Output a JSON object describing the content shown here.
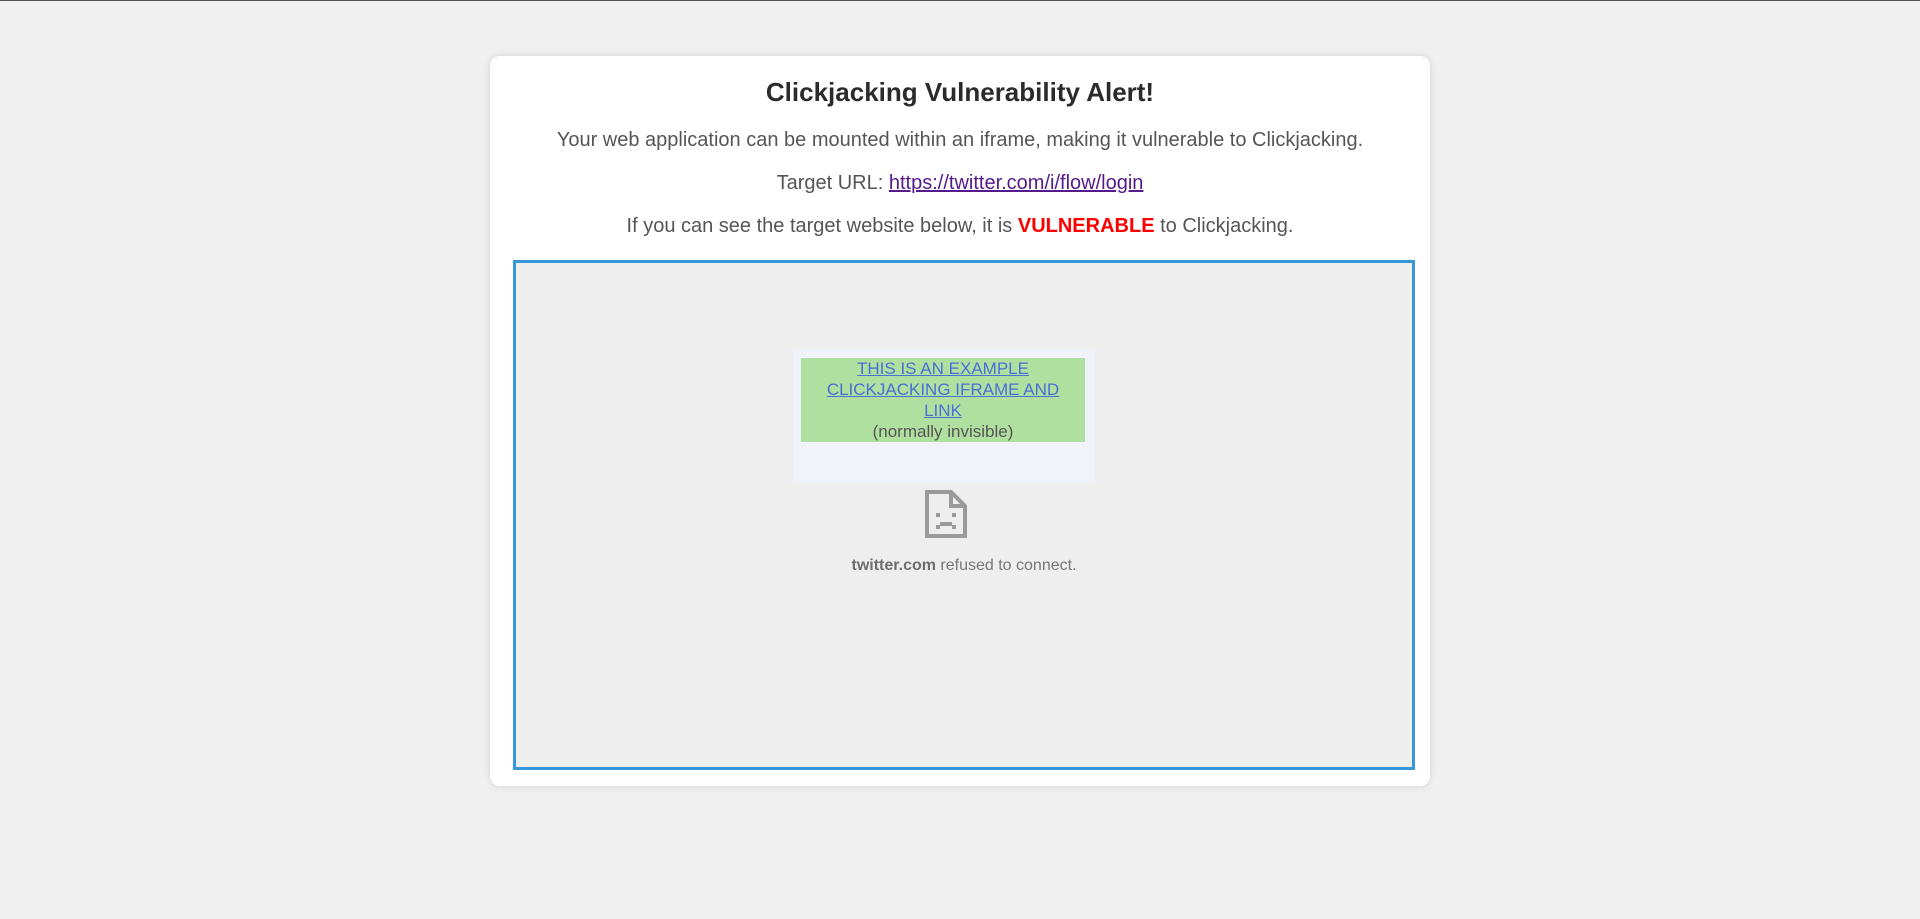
{
  "alert": {
    "title": "Clickjacking Vulnerability Alert!",
    "description": "Your web application can be mounted within an iframe, making it vulnerable to Clickjacking.",
    "target_label": "Target URL: ",
    "target_url": "https://twitter.com/i/flow/login",
    "instruction_prefix": "If you can see the target website below, it is ",
    "instruction_emphasis": "VULNERABLE",
    "instruction_suffix": " to Clickjacking."
  },
  "iframe": {
    "overlay_link": "THIS IS AN EXAMPLE CLICKJACKING IFRAME AND LINK",
    "overlay_note": "(normally invisible)",
    "error_icon": "sad-document-icon",
    "refused_host": "twitter.com",
    "refused_text": " refused to connect."
  },
  "colors": {
    "vulnerable": "#ff0000",
    "frame_border": "#3498db",
    "overlay_bg": "#b0e0a0"
  }
}
